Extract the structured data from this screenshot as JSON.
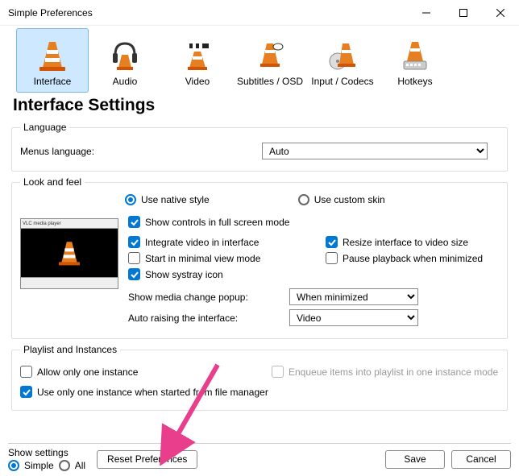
{
  "window": {
    "title": "Simple Preferences"
  },
  "categories": [
    {
      "label": "Interface",
      "selected": true
    },
    {
      "label": "Audio"
    },
    {
      "label": "Video"
    },
    {
      "label": "Subtitles / OSD"
    },
    {
      "label": "Input / Codecs"
    },
    {
      "label": "Hotkeys"
    }
  ],
  "page_title": "Interface Settings",
  "language": {
    "legend": "Language",
    "menus_label": "Menus language:",
    "value": "Auto"
  },
  "lookfeel": {
    "legend": "Look and feel",
    "native_label": "Use native style",
    "custom_label": "Use custom skin",
    "checks": {
      "fullscreen_controls": "Show controls in full screen mode",
      "integrate_video": "Integrate video in interface",
      "resize_interface": "Resize interface to video size",
      "minimal_view": "Start in minimal view mode",
      "pause_minimized": "Pause playback when minimized",
      "systray": "Show systray icon"
    },
    "media_popup_label": "Show media change popup:",
    "media_popup_value": "When minimized",
    "auto_raise_label": "Auto raising the interface:",
    "auto_raise_value": "Video"
  },
  "playlist": {
    "legend": "Playlist and Instances",
    "one_instance": "Allow only one instance",
    "enqueue": "Enqueue items into playlist in one instance mode",
    "one_instance_fm": "Use only one instance when started from file manager"
  },
  "bottom": {
    "show_settings": "Show settings",
    "simple": "Simple",
    "all": "All",
    "reset": "Reset Preferences",
    "save": "Save",
    "cancel": "Cancel"
  },
  "annotation": {
    "color": "#e83e8c"
  }
}
